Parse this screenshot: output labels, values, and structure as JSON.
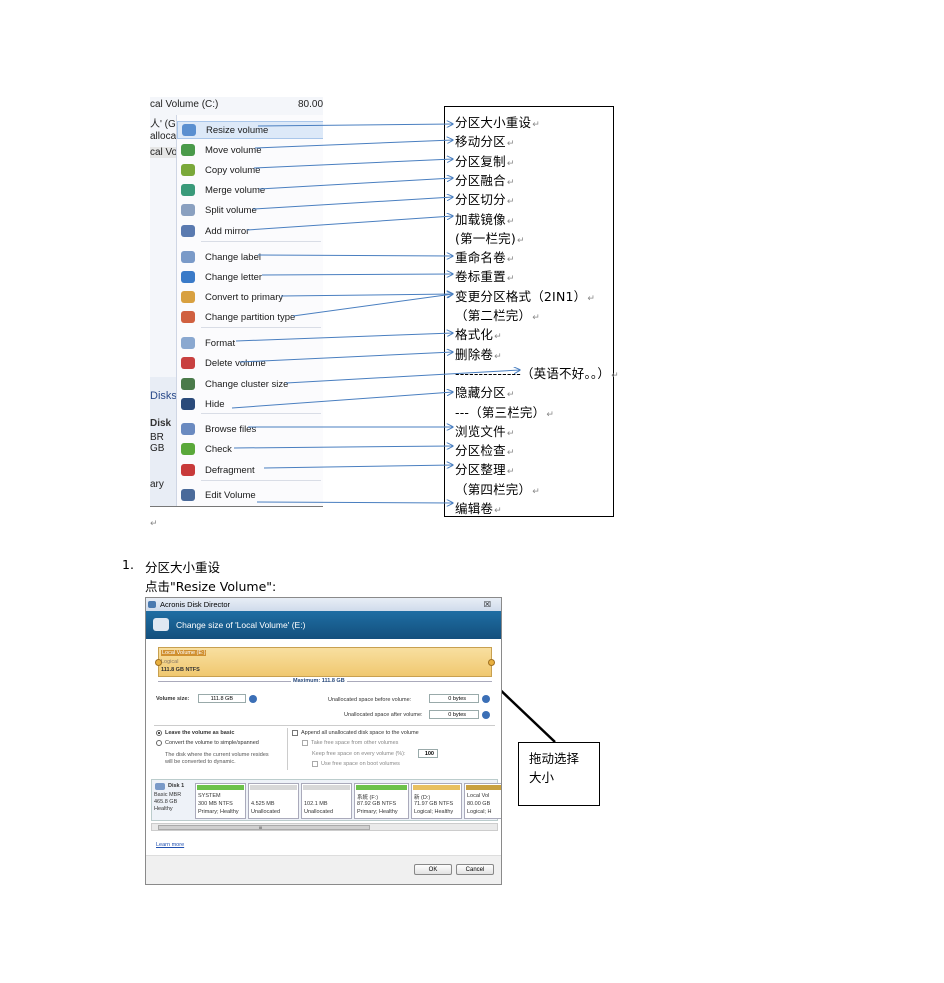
{
  "menu_background": {
    "row1_left": "cal Volume (C:)",
    "row1_right": "80.00",
    "row2": "人' (G",
    "row3": "alloca",
    "row4": "cal Vo",
    "disks_left": "Disks",
    "disk_left": "Disk",
    "br_left": "BR",
    "gb_left": "GB",
    "ary_left": "ary"
  },
  "menu_items": [
    {
      "label": "Resize volume",
      "icon": "resize-icon",
      "color": "#5a8fd0",
      "highlight": true
    },
    {
      "label": "Move volume",
      "icon": "move-icon",
      "color": "#4a9a4a"
    },
    {
      "label": "Copy volume",
      "icon": "copy-icon",
      "color": "#7aa83a"
    },
    {
      "label": "Merge volume",
      "icon": "merge-icon",
      "color": "#3a9a7a"
    },
    {
      "label": "Split volume",
      "icon": "split-icon",
      "color": "#8aa0c0"
    },
    {
      "label": "Add mirror",
      "icon": "mirror-icon",
      "color": "#5a7ab0"
    },
    {
      "label": "Change label",
      "icon": "label-icon",
      "color": "#7a9ac8"
    },
    {
      "label": "Change letter",
      "icon": "letter-icon",
      "color": "#3a7ac8"
    },
    {
      "label": "Convert to primary",
      "icon": "convert-icon",
      "color": "#d8a040"
    },
    {
      "label": "Change partition type",
      "icon": "partition-type-icon",
      "color": "#d06040"
    },
    {
      "label": "Format",
      "icon": "format-icon",
      "color": "#8aa8d0"
    },
    {
      "label": "Delete volume",
      "icon": "delete-icon",
      "color": "#c84040"
    },
    {
      "label": "Change cluster size",
      "icon": "cluster-icon",
      "color": "#4a7a4a"
    },
    {
      "label": "Hide",
      "icon": "hide-icon",
      "color": "#2a4a7a"
    },
    {
      "label": "Browse files",
      "icon": "browse-icon",
      "color": "#6a8ac0"
    },
    {
      "label": "Check",
      "icon": "check-icon",
      "color": "#5aa83a"
    },
    {
      "label": "Defragment",
      "icon": "defragment-icon",
      "color": "#c83a3a"
    },
    {
      "label": "Edit Volume",
      "icon": "edit-icon",
      "color": "#4a6a9a"
    }
  ],
  "chinese_labels": [
    "分区大小重设",
    "移动分区",
    "分区复制",
    "分区融合",
    "分区切分",
    "加载镜像",
    "(第一栏完)",
    "重命名卷",
    "卷标重置",
    "变更分区格式（2IN1）",
    "（第二栏完）",
    "格式化",
    "删除卷",
    "--------------（英语不好。。）",
    "隐藏分区",
    "---（第三栏完）",
    "浏览文件",
    "分区检查",
    "分区整理",
    "（第四栏完）",
    "编辑卷"
  ],
  "paragraph_mark": "↵",
  "section": {
    "number": "1.",
    "title": "分区大小重设",
    "instruction": "点击\"Resize Volume\":"
  },
  "dialog": {
    "app_title": "Acronis Disk Director",
    "close_glyph": "☒",
    "header": "Change size of 'Local Volume' (E:)",
    "volume_label": "Local Volume (E:)",
    "volume_type": "Logical",
    "volume_size_fs": "111.8 GB NTFS",
    "maximum": "Maximum: 111.8 GB",
    "volume_size_label": "Volume size:",
    "volume_size_value": "111.8 GB",
    "unalloc_before_label": "Unallocated space before volume:",
    "unalloc_before_value": "0 bytes",
    "unalloc_after_label": "Unallocated space after volume:",
    "unalloc_after_value": "0 bytes",
    "radio_basic": "Leave the volume as basic",
    "radio_convert": "Convert the volume to simple/spanned",
    "convert_note1": "The disk where the current volume resides",
    "convert_note2": "will be converted to dynamic.",
    "append_unalloc": "Append all unallocated disk space to the volume",
    "take_free": "Take free space from other volumes",
    "keep_free": "Keep free space on every volume (%):",
    "keep_free_value": "100",
    "use_free_boot": "Use free space on boot volumes",
    "disk": {
      "name": "Disk 1",
      "type": "Basic MBR",
      "size": "465.8 GB",
      "status": "Healthy"
    },
    "partitions": [
      {
        "name": "SYSTEM",
        "size": "300 MB NTFS",
        "state": "Primary; Healthy",
        "color": "#6cc24a"
      },
      {
        "name": "",
        "size": "4.525 MB",
        "state": "Unallocated",
        "color": "#d8d8d8"
      },
      {
        "name": "",
        "size": "102.1 MB",
        "state": "Unallocated",
        "color": "#d8d8d8"
      },
      {
        "name": "系統 (F:)",
        "size": "87.92 GB NTFS",
        "state": "Primary; Healthy",
        "color": "#6cc24a"
      },
      {
        "name": "新 (D:)",
        "size": "71.97 GB NTFS",
        "state": "Logical; Healthy",
        "color": "#e8c060"
      },
      {
        "name": "Local Vol",
        "size": "80.00 GB",
        "state": "Logical; H",
        "color": "#c8a040"
      }
    ],
    "scroll_marker": "III",
    "learn_more": "Learn more",
    "ok": "OK",
    "cancel": "Cancel"
  },
  "callout": {
    "line1": "拖动选择",
    "line2": "大小"
  }
}
